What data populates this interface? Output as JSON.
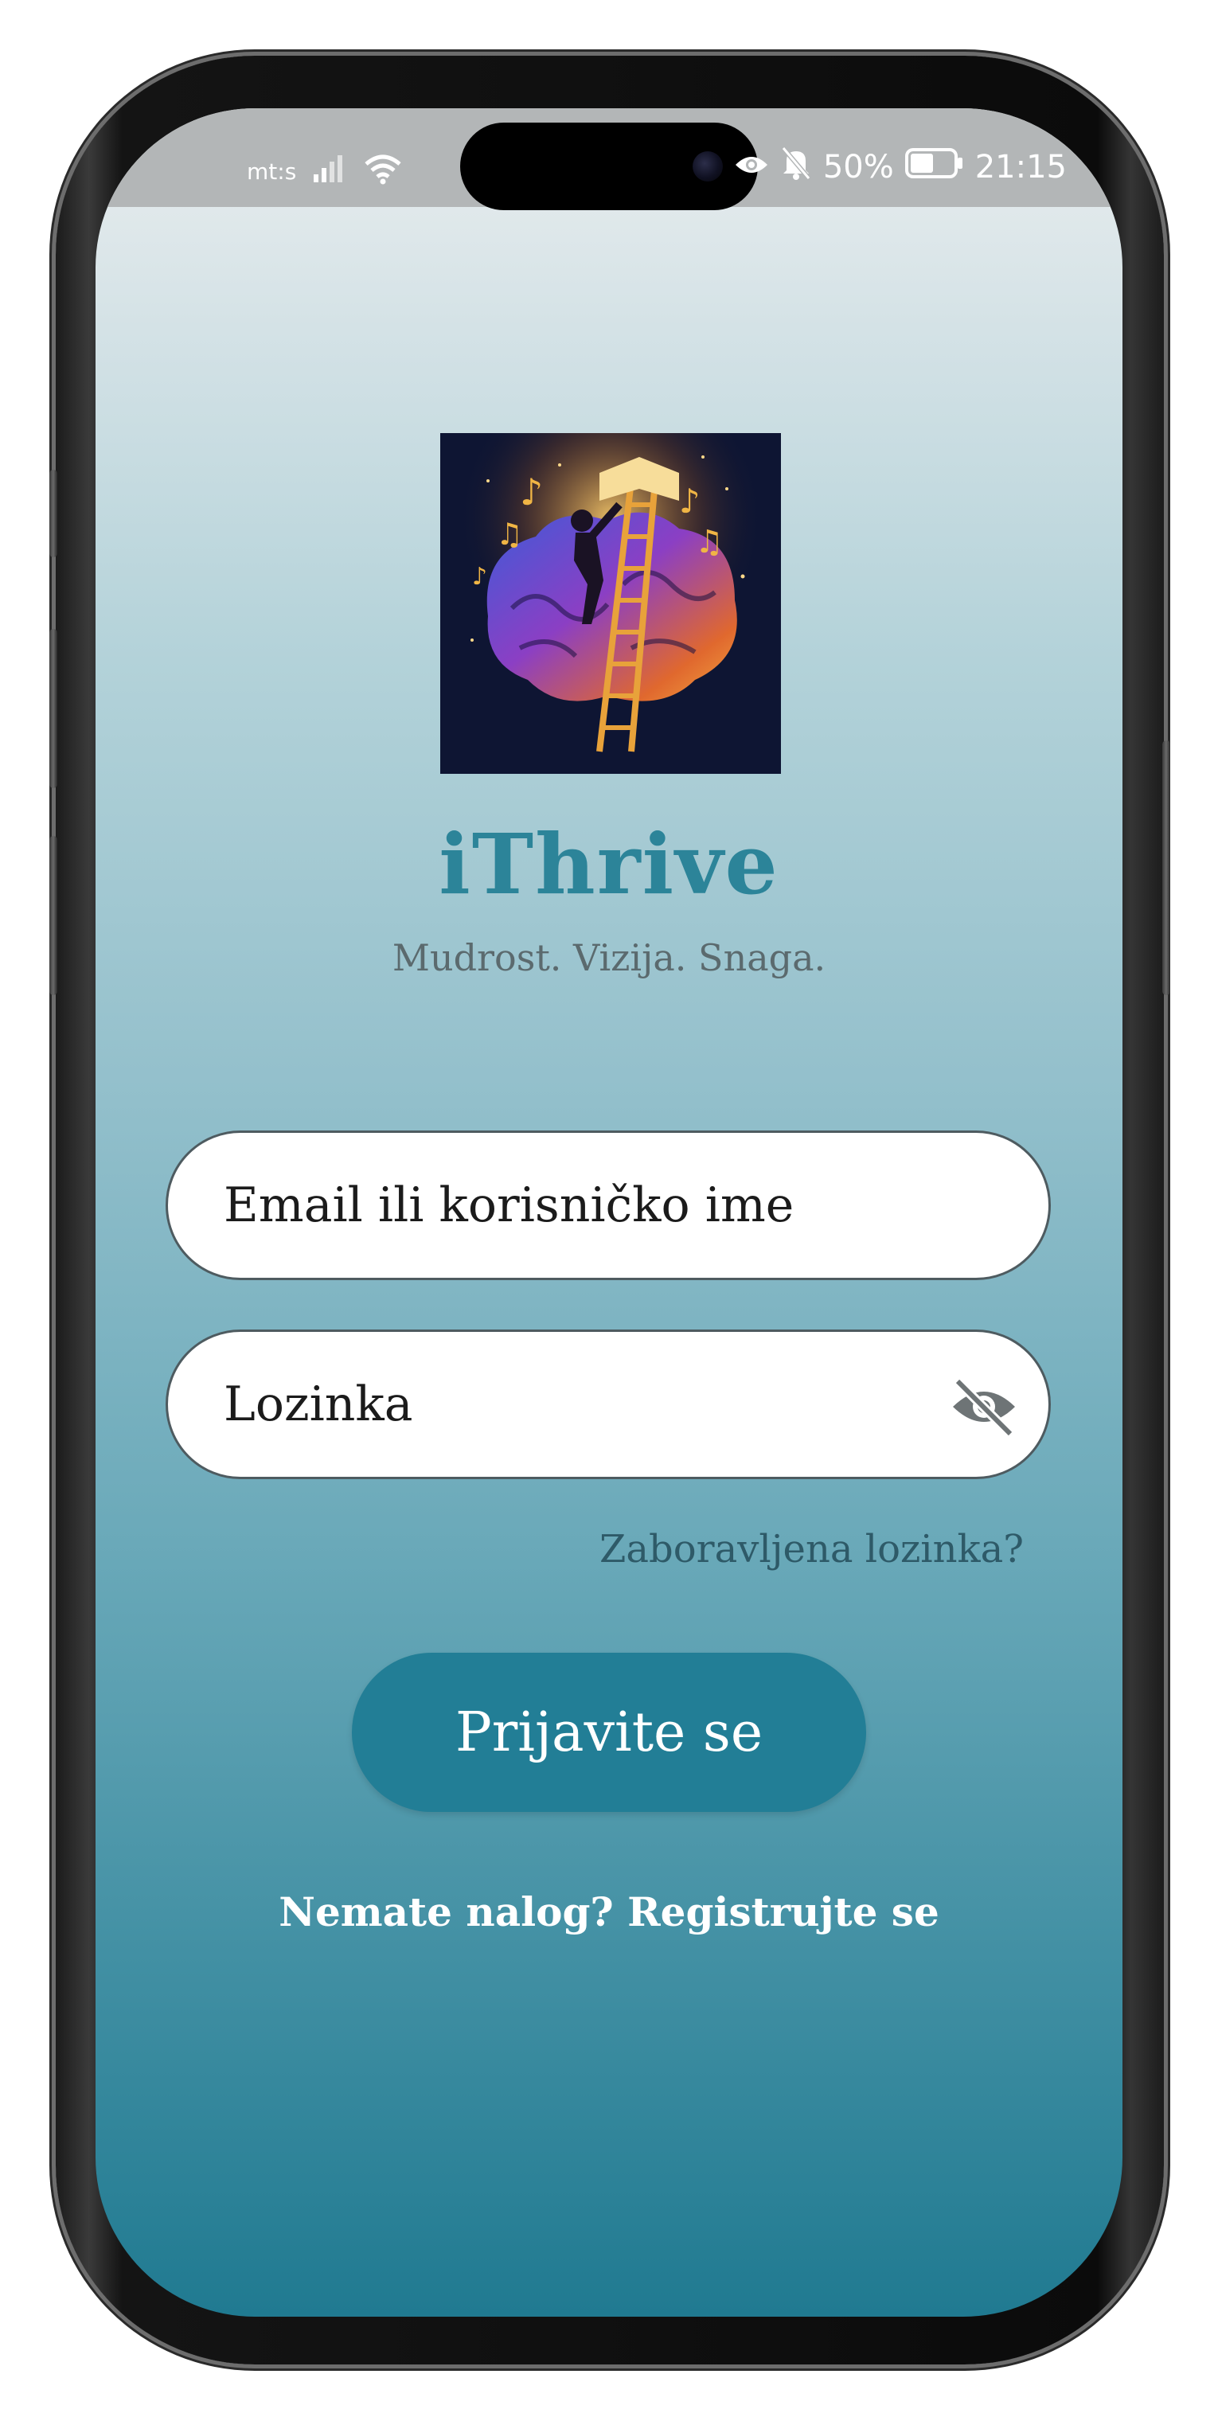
{
  "status_bar": {
    "carrier": "mt:s",
    "battery": "50%",
    "time": "21:15",
    "icons": [
      "signal-icon",
      "wifi-icon",
      "eye-icon",
      "bell-off-icon",
      "battery-icon"
    ]
  },
  "app": {
    "title": "iThrive",
    "tagline": "Mudrost. Vizija. Snaga.",
    "logo_icon": "brain-ladder-logo"
  },
  "login_form": {
    "email_placeholder": "Email ili korisničko ime",
    "password_placeholder": "Lozinka",
    "forgot_password": "Zaboravljena lozinka?",
    "submit_label": "Prijavite se",
    "register_text": "Nemate nalog? Registrujte se"
  },
  "colors": {
    "accent": "#227e96",
    "title": "#2c8499",
    "gradient_top": "#eaeeef",
    "gradient_bottom": "#207a91"
  }
}
